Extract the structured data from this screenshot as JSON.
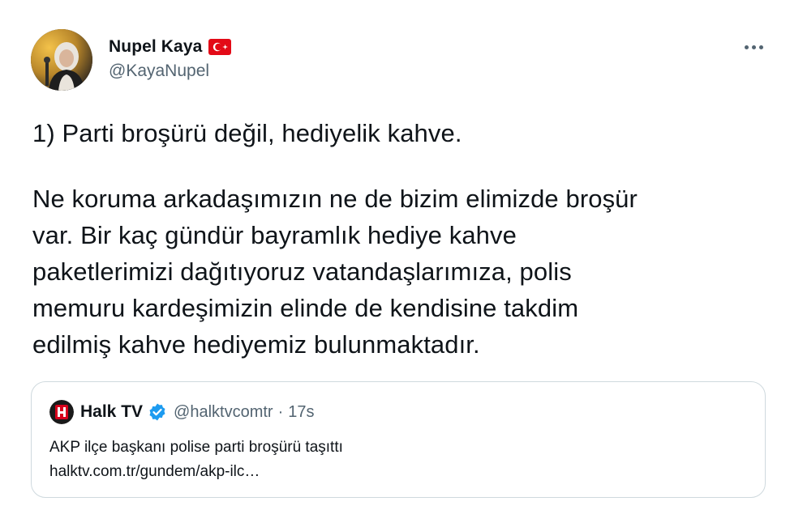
{
  "author": {
    "display_name": "Nupel Kaya",
    "handle": "@KayaNupel",
    "flag_icon": "turkey-flag-icon",
    "flag_color": "#e30a17"
  },
  "tweet": {
    "line1": "1) Parti broşürü değil, hediyelik kahve.",
    "paragraph2": "Ne koruma arkadaşımızın ne de bizim elimizde broşür\nvar. Bir kaç gündür bayramlık hediye kahve\npaketlerimizi dağıtıyoruz vatandaşlarımıza, polis\nmemuru kardeşimizin elinde de kendisine takdim\nedilmiş kahve hediyemiz bulunmaktadır."
  },
  "quoted_tweet": {
    "display_name": "Halk TV",
    "handle": "@halktvcomtr",
    "separator": "·",
    "time": "17s",
    "text": "AKP ilçe başkanı polise parti broşürü taşıttı",
    "link": "halktv.com.tr/gundem/akp-ilc…",
    "verified_color": "#1d9bf0",
    "logo_color": "#d6001c"
  },
  "colors": {
    "text_primary": "#0f1419",
    "text_secondary": "#536471",
    "border": "#cfd9de"
  }
}
